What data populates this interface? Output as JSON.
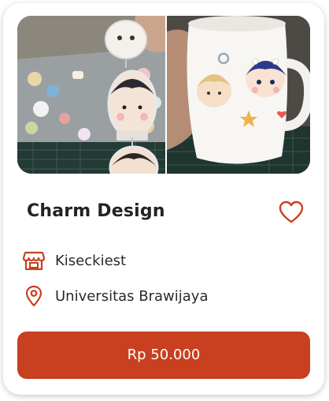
{
  "product": {
    "name": "Charm Design",
    "shop_name": "Kiseckiest",
    "location": "Universitas Brawijaya",
    "price_label": "Rp 50.000"
  },
  "icons": {
    "favorite": "heart-outline-icon",
    "shop": "store-icon",
    "location": "map-pin-icon"
  },
  "colors": {
    "accent": "#c8401f",
    "text": "#232323"
  }
}
